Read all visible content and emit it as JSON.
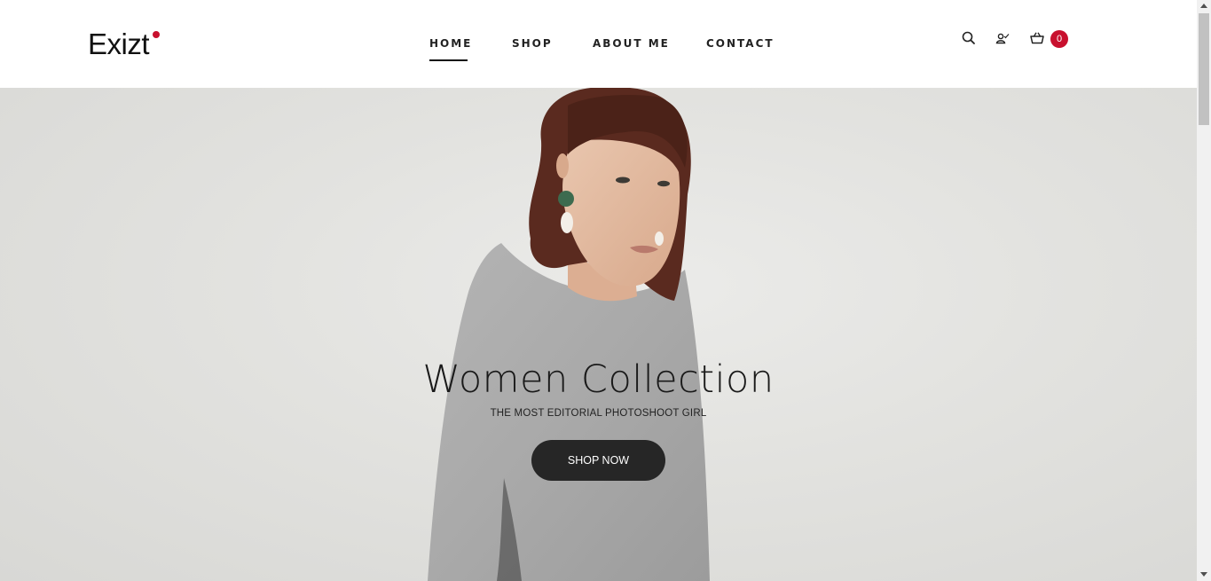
{
  "brand": {
    "logo_text": "Exizt",
    "accent": "#c8102e"
  },
  "nav": {
    "items": [
      {
        "label": "HOME",
        "active": true
      },
      {
        "label": "SHOP",
        "active": false
      },
      {
        "label": "ABOUT ME",
        "active": false
      },
      {
        "label": "CONTACT",
        "active": false
      }
    ]
  },
  "header_icons": {
    "search": "search-icon",
    "account": "user-icon",
    "cart": "basket-icon",
    "cart_count": "0"
  },
  "hero": {
    "title": "Women Collection",
    "subtitle": "THE MOST EDITORIAL PHOTOSHOOT GIRL",
    "button_label": "SHOP NOW"
  }
}
